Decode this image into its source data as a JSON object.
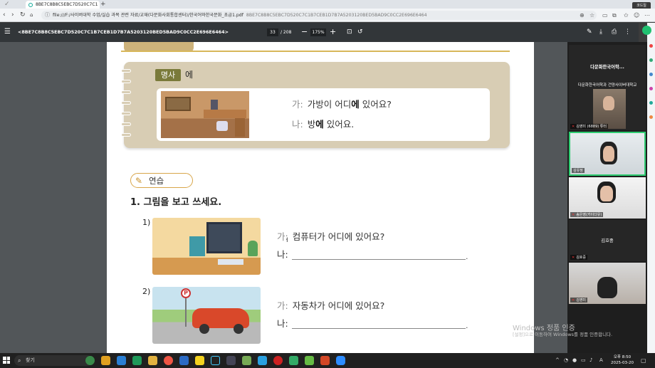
{
  "browser": {
    "tab_title": "8BE7C8B8C5EBC7D520C7C1",
    "tab_new": "+",
    "window_tag": "코드일",
    "url_main": "file:///F:/사이버대학 수업/실습 과목 관련 자료/교재(다문화사회통합센터)/한국어와한국문화_초급1.pdf",
    "url_sub": "8BE7C8B8C5EBC7D520C7C1B7CEB1D7B7A5203120BED5BAD9C0CC2E696E6464"
  },
  "pdf_toolbar": {
    "filename": "<8BE7C8B8C5EBC7D520C7C1B7CEB1D7B7A5203120BED5BAD9C0CC2E696E6464>",
    "page_current": "33",
    "page_total": "/ 208",
    "zoom": "175%"
  },
  "lesson": {
    "grammar_badge": "명사",
    "grammar_particle": "에",
    "example_q_speaker": "가:",
    "example_q_pre": "가방이 어디",
    "example_q_bold": "에",
    "example_q_post": " 있어요?",
    "example_a_speaker": "나:",
    "example_a_pre": "방",
    "example_a_bold": "에",
    "example_a_post": " 있어요.",
    "practice_label": "연습",
    "instruction": "1. 그림을 보고 쓰세요.",
    "items": [
      {
        "num": "1)",
        "q_speaker": "가:",
        "question": "컴퓨터가 어디에 있어요?",
        "a_speaker": "나:",
        "end": "."
      },
      {
        "num": "2)",
        "q_speaker": "가:",
        "question": "자동차가 어디에 있어요?",
        "a_speaker": "나:",
        "end": "."
      }
    ]
  },
  "video": {
    "tiles": [
      {
        "title": "다문화한국어학...",
        "subtitle": "다문화한국어학과 건양사이버대학교",
        "label": "김영미 (6889) 튜터"
      },
      {
        "label": "김유정"
      },
      {
        "label": "송은영(카이더유)"
      },
      {
        "title": "김호중",
        "label": "김호중"
      },
      {
        "label": "김영미"
      }
    ]
  },
  "watermark": {
    "line1": "Windows 정품 인증",
    "line2": "[설정]으로 이동하여 Windows를 정품 인증합니다."
  },
  "taskbar": {
    "search_label": "찾기",
    "time": "오후 8:50",
    "date": "2025-03-20",
    "lang": "A"
  }
}
